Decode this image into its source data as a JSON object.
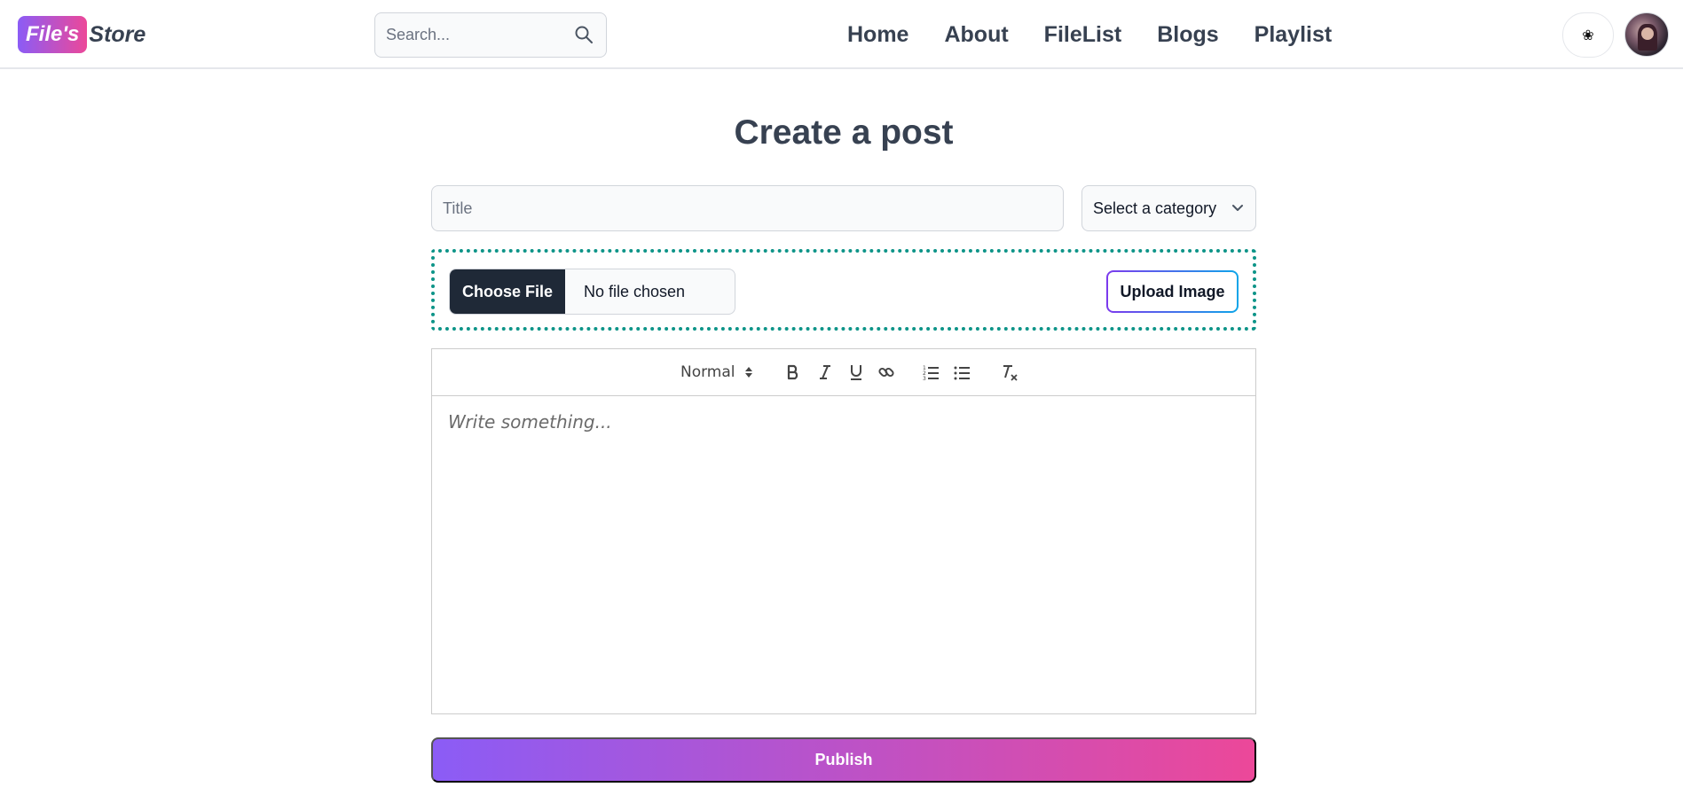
{
  "logo": {
    "badge": "File's",
    "text": "Store"
  },
  "search": {
    "placeholder": "Search..."
  },
  "nav": {
    "items": [
      "Home",
      "About",
      "FileList",
      "Blogs",
      "Playlist"
    ]
  },
  "theme_toggle": {
    "icon": "❀"
  },
  "page": {
    "title": "Create a post"
  },
  "form": {
    "title_placeholder": "Title",
    "category_value": "Select a category",
    "choose_file_label": "Choose File",
    "no_file_text": "No file chosen",
    "upload_label": "Upload Image",
    "editor_header_value": "Normal",
    "editor_placeholder": "Write something...",
    "publish_label": "Publish"
  },
  "colors": {
    "accent_start": "#8b5cf6",
    "accent_end": "#ec4899",
    "dropzone_border": "#0d9488",
    "dark_button": "#1f2937"
  }
}
